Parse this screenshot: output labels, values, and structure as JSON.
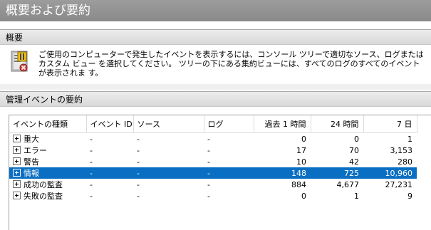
{
  "window_title": "概要および要約",
  "overview": {
    "header": "概要",
    "icon": "event-viewer-icon",
    "text": "ご使用のコンピューターで発生したイベントを表示するには、コンソール ツリーで適切なソース、ログまたはカスタム ビュー を選択してください。 ツリーの下にある集約ビューには、すべてのログのすべてのイベントが表示されま す。"
  },
  "summary": {
    "header": "管理イベントの要約",
    "columns": [
      "イベントの種類",
      "イベント ID",
      "ソース",
      "ログ",
      "過去 1 時間",
      "24 時間",
      "7 日"
    ],
    "rows": [
      {
        "type": "重大",
        "event_id": "-",
        "source": "-",
        "log": "-",
        "hour": "0",
        "day": "0",
        "week": "1"
      },
      {
        "type": "エラー",
        "event_id": "-",
        "source": "-",
        "log": "-",
        "hour": "17",
        "day": "70",
        "week": "3,153"
      },
      {
        "type": "警告",
        "event_id": "-",
        "source": "-",
        "log": "-",
        "hour": "10",
        "day": "42",
        "week": "280"
      },
      {
        "type": "情報",
        "event_id": "-",
        "source": "-",
        "log": "-",
        "hour": "148",
        "day": "725",
        "week": "10,960",
        "selected": true
      },
      {
        "type": "成功の監査",
        "event_id": "-",
        "source": "-",
        "log": "-",
        "hour": "884",
        "day": "4,677",
        "week": "27,231"
      },
      {
        "type": "失敗の監査",
        "event_id": "-",
        "source": "-",
        "log": "-",
        "hour": "0",
        "day": "1",
        "week": "9"
      }
    ],
    "selection_color": "#0a6fc2"
  }
}
